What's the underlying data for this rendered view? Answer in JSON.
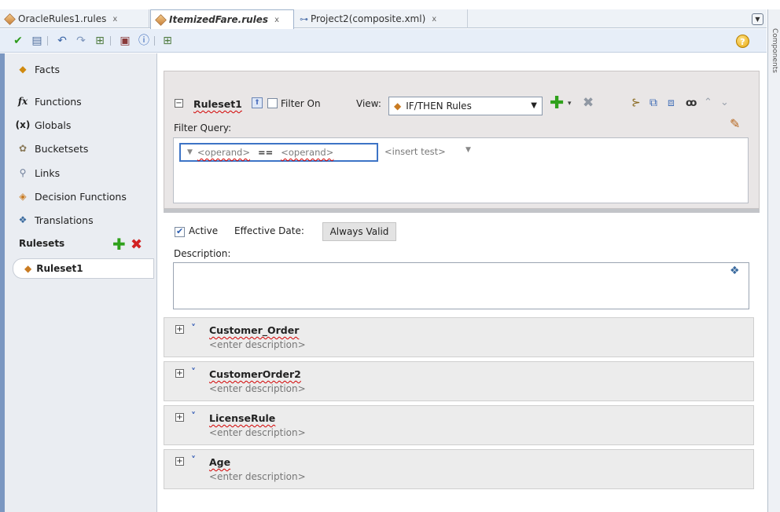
{
  "tabs": [
    {
      "label": "OracleRules1.rules",
      "close": "x"
    },
    {
      "label": "ItemizedFare.rules",
      "close": "x"
    },
    {
      "label": "Project2(composite.xml)",
      "close": "x"
    }
  ],
  "toolbar": {
    "icons": [
      "validate-check-icon",
      "book-icon",
      "undo-icon",
      "redo-icon",
      "composite-icon",
      "report-icon",
      "info-icon",
      "composite2-icon"
    ],
    "help": "?"
  },
  "right_strip_text": "Components",
  "sidebar": {
    "items": [
      {
        "label": "Facts",
        "icon": "facts-icon"
      },
      {
        "label": "Functions",
        "icon": "fx-icon",
        "glyph": "fx"
      },
      {
        "label": "Globals",
        "icon": "globals-icon",
        "glyph": "(x)"
      },
      {
        "label": "Bucketsets",
        "icon": "bucketsets-icon"
      },
      {
        "label": "Links",
        "icon": "links-icon"
      },
      {
        "label": "Decision Functions",
        "icon": "decision-functions-icon"
      },
      {
        "label": "Translations",
        "icon": "translations-icon"
      }
    ],
    "rulesets_label": "Rulesets",
    "add_symbol": "✚",
    "delete_symbol": "✖",
    "ruleset_items": [
      "Ruleset1"
    ]
  },
  "ruleset": {
    "name": "Ruleset1",
    "filter_on_label": "Filter On",
    "view_label": "View:",
    "view_value": "IF/THEN Rules",
    "filter_query_label": "Filter Query:",
    "operand_left": "<operand>",
    "operator": "==",
    "operand_right": "<operand>",
    "insert_test": "<insert test>"
  },
  "settings": {
    "active_label": "Active",
    "effective_date_label": "Effective Date:",
    "effective_date_value": "Always Valid",
    "description_label": "Description:"
  },
  "rules": [
    {
      "name": "Customer_Order",
      "desc": "<enter description>"
    },
    {
      "name": "CustomerOrder2",
      "desc": "<enter description>"
    },
    {
      "name": "LicenseRule",
      "desc": "<enter description>"
    },
    {
      "name": "Age",
      "desc": "<enter description>"
    }
  ],
  "colors": {
    "accent_blue": "#3d74c6",
    "add_green": "#2fa11b",
    "delete_red": "#d22222"
  }
}
